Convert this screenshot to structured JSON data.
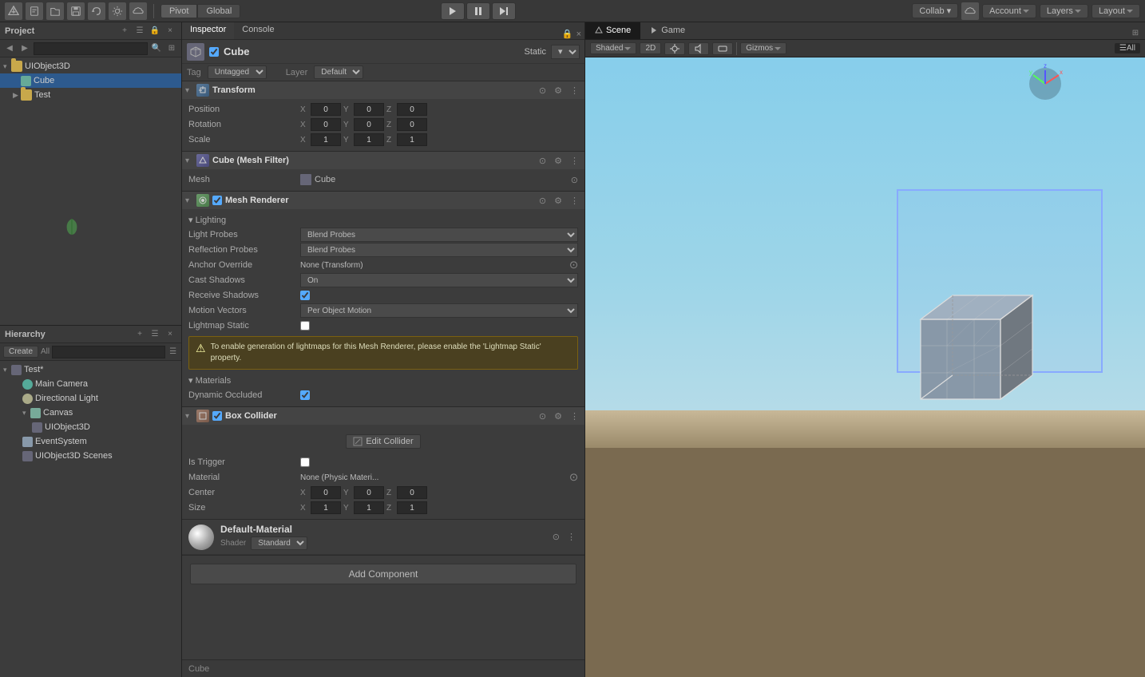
{
  "topbar": {
    "pivot_label": "Pivot",
    "global_label": "Global",
    "play_tooltip": "Play",
    "pause_tooltip": "Pause",
    "step_tooltip": "Step",
    "collab_label": "Collab",
    "account_label": "Account",
    "layers_label": "Layers",
    "layout_label": "Layout"
  },
  "project": {
    "title": "Project",
    "search_placeholder": "",
    "items": [
      {
        "label": "UIObject3D",
        "type": "folder",
        "indent": 0,
        "expanded": true
      },
      {
        "label": "Cube",
        "type": "scene",
        "indent": 1,
        "selected": true
      },
      {
        "label": "Test",
        "type": "folder",
        "indent": 1,
        "expanded": false
      }
    ]
  },
  "hierarchy": {
    "title": "Hierarchy",
    "create_label": "Create",
    "all_label": "All",
    "items": [
      {
        "label": "Test*",
        "indent": 0,
        "expanded": true,
        "dirty": true
      },
      {
        "label": "Main Camera",
        "indent": 1
      },
      {
        "label": "Directional Light",
        "indent": 1
      },
      {
        "label": "Canvas",
        "indent": 1,
        "expanded": true
      },
      {
        "label": "UIObject3D",
        "indent": 2
      },
      {
        "label": "EventSystem",
        "indent": 1
      },
      {
        "label": "UIObject3D Scenes",
        "indent": 1
      }
    ]
  },
  "inspector": {
    "title": "Inspector",
    "console_label": "Console",
    "object_name": "Cube",
    "static_label": "Static",
    "tag_label": "Tag",
    "tag_value": "Untagged",
    "layer_label": "Layer",
    "layer_value": "Default",
    "transform": {
      "title": "Transform",
      "position_label": "Position",
      "pos_x": "0",
      "pos_y": "0",
      "pos_z": "0",
      "rotation_label": "Rotation",
      "rot_x": "0",
      "rot_y": "0",
      "rot_z": "0",
      "scale_label": "Scale",
      "scale_x": "1",
      "scale_y": "1",
      "scale_z": "1"
    },
    "mesh_filter": {
      "title": "Cube (Mesh Filter)",
      "mesh_label": "Mesh",
      "mesh_value": "Cube"
    },
    "mesh_renderer": {
      "title": "Mesh Renderer",
      "lighting_label": "Lighting",
      "light_probes_label": "Light Probes",
      "light_probes_value": "Blend Probes",
      "reflection_probes_label": "Reflection Probes",
      "reflection_probes_value": "Blend Probes",
      "anchor_override_label": "Anchor Override",
      "anchor_override_value": "None (Transform)",
      "cast_shadows_label": "Cast Shadows",
      "cast_shadows_value": "On",
      "receive_shadows_label": "Receive Shadows",
      "motion_vectors_label": "Motion Vectors",
      "motion_vectors_value": "Per Object Motion",
      "lightmap_static_label": "Lightmap Static",
      "warning_text": "To enable generation of lightmaps for this Mesh Renderer, please enable the 'Lightmap Static' property.",
      "materials_label": "Materials",
      "dynamic_occluded_label": "Dynamic Occluded"
    },
    "box_collider": {
      "title": "Box Collider",
      "edit_collider_label": "Edit Collider",
      "is_trigger_label": "Is Trigger",
      "material_label": "Material",
      "material_value": "None (Physic Materi...",
      "center_label": "Center",
      "cx": "0",
      "cy": "0",
      "cz": "0",
      "size_label": "Size",
      "sx": "1",
      "sy": "1",
      "sz": "1"
    },
    "material": {
      "name": "Default-Material",
      "shader_label": "Shader",
      "shader_value": "Standard"
    },
    "add_component_label": "Add Component",
    "bottom_label": "Cube"
  },
  "scene": {
    "scene_tab": "Scene",
    "game_tab": "Game",
    "shaded_label": "Shaded",
    "twod_label": "2D",
    "gizmos_label": "Gizmos",
    "all_label": "All"
  }
}
